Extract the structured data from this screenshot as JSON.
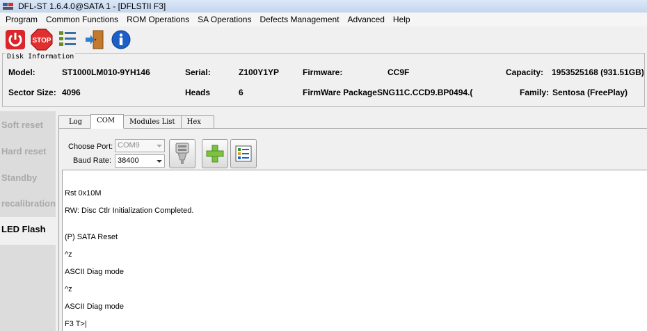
{
  "window": {
    "title": "DFL-ST 1.6.4.0@SATA 1 - [DFLSTII F3]"
  },
  "menu": [
    "Program",
    "Common Functions",
    "ROM Operations",
    "SA Operations",
    "Defects Management",
    "Advanced",
    "Help"
  ],
  "toolbar": {
    "buttons": [
      {
        "icon": "power-icon"
      },
      {
        "icon": "stop-icon",
        "text": "STOP"
      },
      {
        "icon": "list-icon"
      },
      {
        "icon": "exit-door-icon"
      },
      {
        "icon": "info-icon"
      }
    ]
  },
  "disk_info": {
    "legend": "Disk Information",
    "model_label": "Model:",
    "model_value": "ST1000LM010-9YH146",
    "serial_label": "Serial:",
    "serial_value": "Z100Y1YP",
    "firmware_label": "Firmware:",
    "firmware_value": "CC9F",
    "capacity_label": "Capacity:",
    "capacity_value": "1953525168 (931.51GB)",
    "sector_label": "Sector Size:",
    "sector_value": "4096",
    "heads_label": "Heads",
    "heads_value": "6",
    "fwpkg_label": "FirmWare Package",
    "fwpkg_value": "SNG11C.CCD9.BP0494.(",
    "family_label": "Family:",
    "family_value": "Sentosa (FreePlay)"
  },
  "sidebar": {
    "items": [
      {
        "label": "Soft reset",
        "active": false
      },
      {
        "label": "Hard reset",
        "active": false
      },
      {
        "label": "Standby",
        "active": false
      },
      {
        "label": "recalibration",
        "active": false
      },
      {
        "label": "LED Flash",
        "active": true
      }
    ]
  },
  "tabs": [
    {
      "label": "Log",
      "active": false
    },
    {
      "label": "COM",
      "active": true
    },
    {
      "label": "Modules List",
      "active": false
    },
    {
      "label": "Hex",
      "active": false
    }
  ],
  "com": {
    "port_label": "Choose Port:",
    "port_value": "COM9",
    "baud_label": "Baud Rate:",
    "baud_value": "38400"
  },
  "console_lines": [
    "Rst 0x10M",
    "RW: Disc Ctlr Initialization Completed.",
    "(P) SATA Reset",
    "^z",
    "ASCII Diag mode",
    "^z",
    "ASCII Diag mode",
    "F3 T>|"
  ],
  "colors": {
    "title_bar": "#c3d6ee",
    "sidebar_bg": "#dcdcdc",
    "sidebar_inactive": "#a9a9a9",
    "stop_red": "#e03030",
    "info_blue": "#1c5fc6"
  }
}
